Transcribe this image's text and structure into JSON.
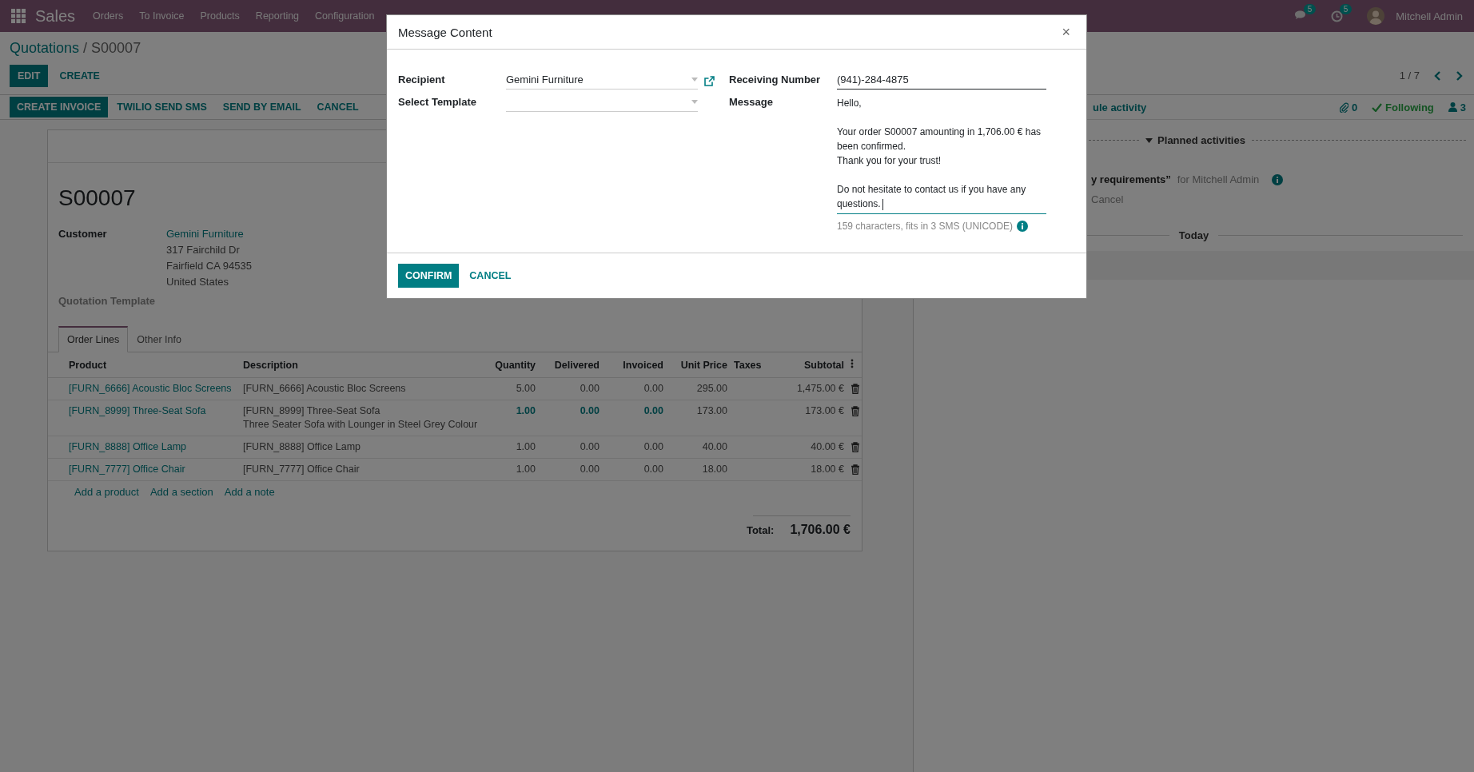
{
  "navbar": {
    "app_name": "Sales",
    "menu": [
      "Orders",
      "To Invoice",
      "Products",
      "Reporting",
      "Configuration"
    ],
    "messages_badge": "5",
    "activities_badge": "5",
    "user": "Mitchell Admin"
  },
  "breadcrumb": {
    "parent": "Quotations",
    "separator": "/",
    "current": "S00007"
  },
  "actions": [
    {
      "label": "EDIT",
      "kind": "primary"
    },
    {
      "label": "CREATE",
      "kind": "secondary"
    }
  ],
  "pager": "1 / 7",
  "status_buttons": [
    {
      "label": "CREATE INVOICE",
      "kind": "primary"
    },
    {
      "label": "TWILIO SEND SMS",
      "kind": "secondary"
    },
    {
      "label": "SEND BY EMAIL",
      "kind": "secondary"
    },
    {
      "label": "CANCEL",
      "kind": "secondary"
    }
  ],
  "sheet": {
    "title": "S00007",
    "customer_label": "Customer",
    "customer_name": "Gemini Furniture",
    "address": [
      "317 Fairchild Dr",
      "Fairfield CA 94535",
      "United States"
    ],
    "template_label": "Quotation Template",
    "tabs": [
      {
        "label": "Order Lines",
        "selected": true
      },
      {
        "label": "Other Info",
        "selected": false
      }
    ],
    "columns": [
      "Product",
      "Description",
      "Quantity",
      "Delivered",
      "Invoiced",
      "Unit Price",
      "Taxes",
      "Subtotal"
    ],
    "rows": [
      {
        "product": "[FURN_6666] Acoustic Bloc Screens",
        "description": [
          "[FURN_6666] Acoustic Bloc Screens"
        ],
        "quantity": "5.00",
        "delivered": "0.00",
        "invoiced": "0.00",
        "unit_price": "295.00",
        "subtotal": "1,475.00 €",
        "highlighted": false
      },
      {
        "product": "[FURN_8999] Three-Seat Sofa",
        "description": [
          "[FURN_8999] Three-Seat Sofa",
          "Three Seater Sofa with Lounger in Steel Grey Colour"
        ],
        "quantity": "1.00",
        "delivered": "0.00",
        "invoiced": "0.00",
        "unit_price": "173.00",
        "subtotal": "173.00 €",
        "highlighted": true
      },
      {
        "product": "[FURN_8888] Office Lamp",
        "description": [
          "[FURN_8888] Office Lamp"
        ],
        "quantity": "1.00",
        "delivered": "0.00",
        "invoiced": "0.00",
        "unit_price": "40.00",
        "subtotal": "40.00 €",
        "highlighted": false
      },
      {
        "product": "[FURN_7777] Office Chair",
        "description": [
          "[FURN_7777] Office Chair"
        ],
        "quantity": "1.00",
        "delivered": "0.00",
        "invoiced": "0.00",
        "unit_price": "18.00",
        "subtotal": "18.00 €",
        "highlighted": false
      }
    ],
    "add_links": [
      "Add a product",
      "Add a section",
      "Add a note"
    ],
    "total_label": "Total:",
    "total": "1,706.00 €"
  },
  "chatter": {
    "schedule_fragment": "ule activity",
    "attachments": "0",
    "follow": "Following",
    "followers": "3",
    "planned_label": "Planned activities",
    "activity": {
      "title_fragment": "y requirements”",
      "assignee": "for Mitchell Admin",
      "action": "Cancel"
    },
    "today": "Today"
  },
  "modal": {
    "title": "Message Content",
    "close": "×",
    "recipient": {
      "label": "Recipient",
      "value": "Gemini Furniture"
    },
    "template": {
      "label": "Select Template"
    },
    "number": {
      "label": "Receiving Number",
      "value": "(941)-284-4875"
    },
    "message": {
      "label": "Message",
      "paragraphs": [
        "Hello,",
        "Your order S00007 amounting in 1,706.00 € has been confirmed.\nThank you for your trust!",
        "Do not hesitate to contact us if you have any questions."
      ],
      "focused": true,
      "counter": "159 characters, fits in 3 SMS (UNICODE)"
    },
    "buttons": [
      {
        "label": "CONFIRM",
        "kind": "primary"
      },
      {
        "label": "CANCEL",
        "kind": "secondary"
      }
    ]
  }
}
